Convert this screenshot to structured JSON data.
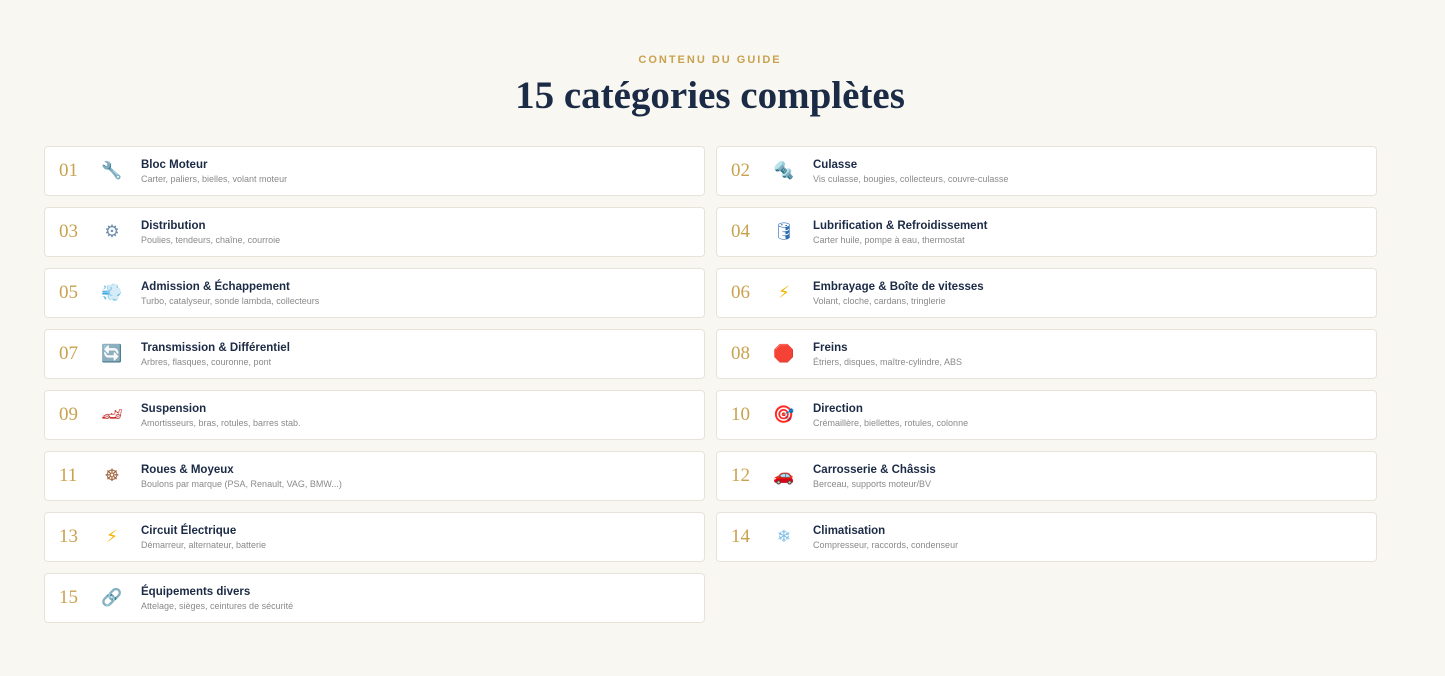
{
  "header": {
    "eyebrow": "CONTENU DU GUIDE",
    "title": "15 catégories complètes"
  },
  "categories": [
    {
      "num": "01",
      "icon": "wrench-icon",
      "glyph": "🔧",
      "color": "#5a7fa6",
      "name": "Bloc Moteur",
      "desc": "Carter, paliers, bielles, volant moteur"
    },
    {
      "num": "02",
      "icon": "nut-bolt-icon",
      "glyph": "🔩",
      "color": "#7a8ca0",
      "name": "Culasse",
      "desc": "Vis culasse, bougies, collecteurs, couvre-culasse"
    },
    {
      "num": "03",
      "icon": "gear-icon",
      "glyph": "⚙",
      "color": "#6d8eb0",
      "name": "Distribution",
      "desc": "Poulies, tendeurs, chaîne, courroie"
    },
    {
      "num": "04",
      "icon": "oil-drum-icon",
      "glyph": "🛢",
      "color": "#2f6fb5",
      "name": "Lubrification & Refroidissement",
      "desc": "Carter huile, pompe à eau, thermostat"
    },
    {
      "num": "05",
      "icon": "wind-icon",
      "glyph": "💨",
      "color": "#8fb4d8",
      "name": "Admission & Échappement",
      "desc": "Turbo, catalyseur, sonde lambda, collecteurs"
    },
    {
      "num": "06",
      "icon": "lightning-icon",
      "glyph": "⚡",
      "color": "#f2b705",
      "name": "Embrayage & Boîte de vitesses",
      "desc": "Volant, cloche, cardans, tringlerie"
    },
    {
      "num": "07",
      "icon": "arrows-cycle-icon",
      "glyph": "🔄",
      "color": "#3a86c8",
      "name": "Transmission & Différentiel",
      "desc": "Arbres, flasques, couronne, pont"
    },
    {
      "num": "08",
      "icon": "stop-sign-icon",
      "glyph": "🛑",
      "color": "#e0322b",
      "name": "Freins",
      "desc": "Étriers, disques, maître-cylindre, ABS"
    },
    {
      "num": "09",
      "icon": "racing-car-icon",
      "glyph": "🏎",
      "color": "#c8312b",
      "name": "Suspension",
      "desc": "Amortisseurs, bras, rotules, barres stab."
    },
    {
      "num": "10",
      "icon": "target-icon",
      "glyph": "🎯",
      "color": "#d9302c",
      "name": "Direction",
      "desc": "Crémaillère, biellettes, rotules, colonne"
    },
    {
      "num": "11",
      "icon": "wheel-icon",
      "glyph": "☸",
      "color": "#a0623a",
      "name": "Roues & Moyeux",
      "desc": "Boulons par marque (PSA, Renault, VAG, BMW...)"
    },
    {
      "num": "12",
      "icon": "car-icon",
      "glyph": "🚗",
      "color": "#d8322c",
      "name": "Carrosserie & Châssis",
      "desc": "Berceau, supports moteur/BV"
    },
    {
      "num": "13",
      "icon": "lightning-icon",
      "glyph": "⚡",
      "color": "#f2b705",
      "name": "Circuit Électrique",
      "desc": "Démarreur, alternateur, batterie"
    },
    {
      "num": "14",
      "icon": "snowflake-icon",
      "glyph": "❄",
      "color": "#7fc0e6",
      "name": "Climatisation",
      "desc": "Compresseur, raccords, condenseur"
    },
    {
      "num": "15",
      "icon": "link-icon",
      "glyph": "🔗",
      "color": "#5a7fa6",
      "name": "Équipements divers",
      "desc": "Attelage, sièges, ceintures de sécurité"
    }
  ]
}
